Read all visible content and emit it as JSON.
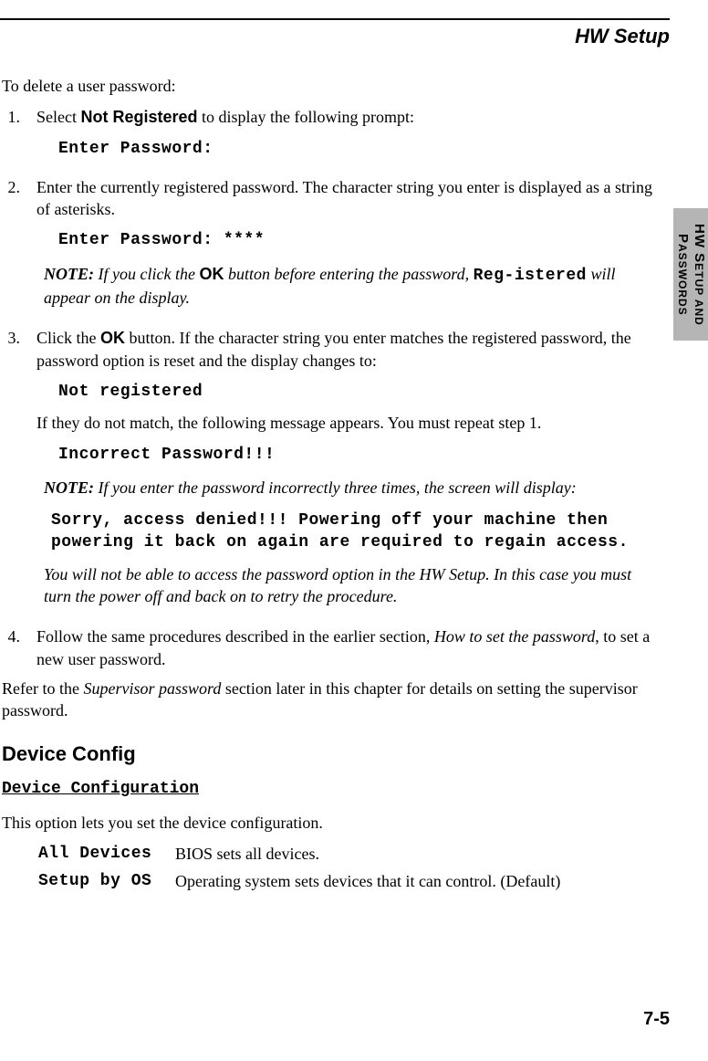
{
  "header": "HW Setup",
  "sideTab": "HW SETUP AND PASSWORDS",
  "intro": "To delete a user password:",
  "step1": {
    "num": "1.",
    "pre": "Select ",
    "bold": "Not Registered",
    "post": " to display the following prompt:",
    "code": "Enter Password:"
  },
  "step2": {
    "num": "2.",
    "text": "Enter the currently registered password. The character string you enter is displayed as a string of asterisks.",
    "code": "Enter Password: ****",
    "note_label": "NOTE:",
    "note_pre": " If you click the ",
    "note_bold": "OK",
    "note_mid": " button before entering the password, ",
    "note_mono": "Reg-istered",
    "note_post": "  will appear on the display."
  },
  "step3": {
    "num": "3.",
    "pre": "Click the ",
    "bold": "OK",
    "post": " button. If the character string you enter matches the registered password, the password option is reset and the display changes to:",
    "code1": "Not registered",
    "followup": "If they do not match, the following message appears. You must repeat step 1.",
    "code2": "Incorrect Password!!!",
    "note_label": "NOTE:",
    "note_text": " If you enter the password incorrectly three times, the screen will display:",
    "code3": "Sorry, access denied!!! Powering off your machine then powering it back on again are required to regain access.",
    "note_after": "You will not be able to access the password option in the HW Setup. In this case you must turn the power off and back on to retry the procedure."
  },
  "step4": {
    "num": "4.",
    "pre": "Follow the same procedures described in the earlier section, ",
    "italic": "How to set the password",
    "post": ", to set a new user password."
  },
  "refer": {
    "pre": "Refer to the ",
    "italic": "Supervisor password",
    "post": " section later in this chapter for details on setting the supervisor password."
  },
  "deviceConfig": {
    "heading": "Device Config",
    "subheading": "Device Configuration",
    "desc": "This option lets you set the device configuration.",
    "row1_label": "All Devices",
    "row1_text": "BIOS sets all devices.",
    "row2_label": "Setup by OS",
    "row2_text": "Operating system sets devices that it can control. (Default)"
  },
  "pageNum": "7-5"
}
